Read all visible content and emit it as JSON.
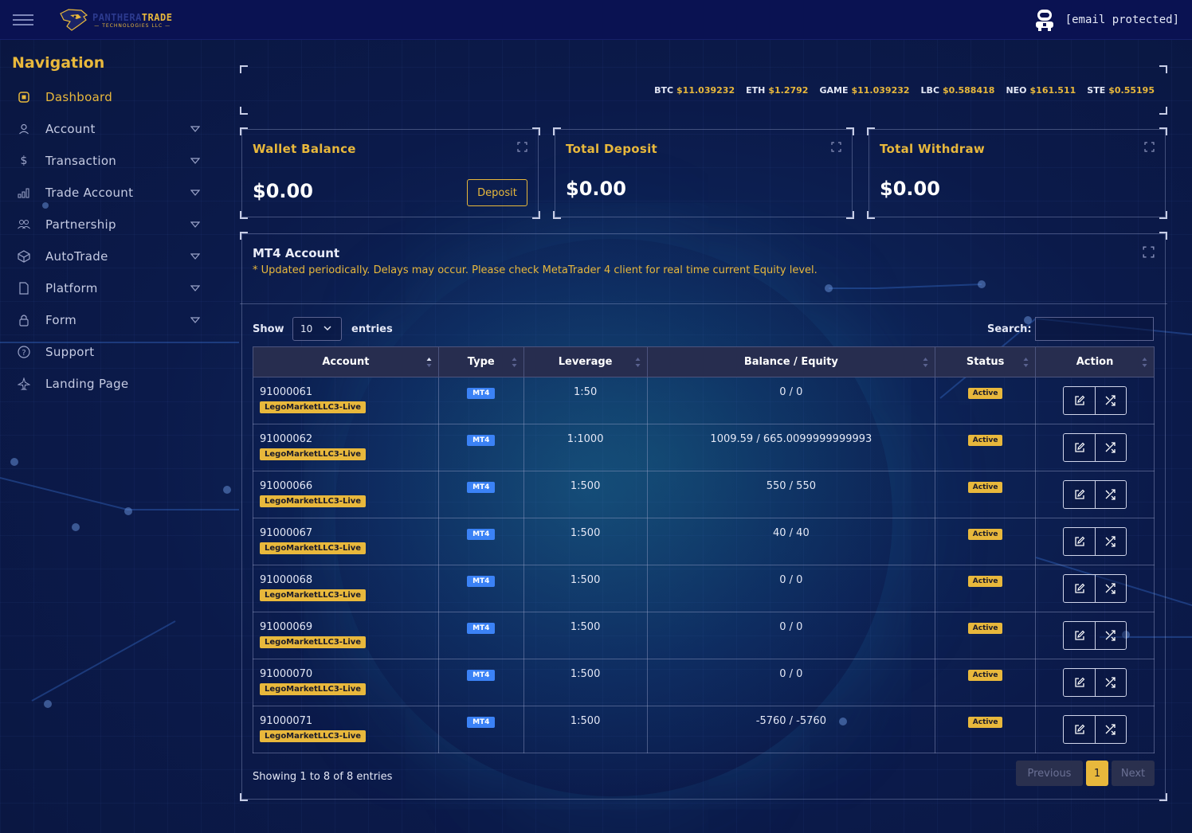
{
  "brand": {
    "name_part1": "PANTHERA",
    "name_part2": "TRADE",
    "tagline": "— TECHNOLOGIES LLC —"
  },
  "user": {
    "email": "[email protected]",
    "avatar_icon": "robot-avatar-icon"
  },
  "sidebar": {
    "title": "Navigation",
    "items": [
      {
        "label": "Dashboard",
        "icon": "chip-icon",
        "active": true,
        "has_submenu": false
      },
      {
        "label": "Account",
        "icon": "user-icon",
        "has_submenu": true
      },
      {
        "label": "Transaction",
        "icon": "dollar-icon",
        "has_submenu": true
      },
      {
        "label": "Trade Account",
        "icon": "bar-chart-icon",
        "has_submenu": true
      },
      {
        "label": "Partnership",
        "icon": "users-icon",
        "has_submenu": true
      },
      {
        "label": "AutoTrade",
        "icon": "cube-icon",
        "has_submenu": true
      },
      {
        "label": "Platform",
        "icon": "file-icon",
        "has_submenu": true
      },
      {
        "label": "Form",
        "icon": "lock-icon",
        "has_submenu": true
      },
      {
        "label": "Support",
        "icon": "help-circle-icon",
        "has_submenu": false
      },
      {
        "label": "Landing Page",
        "icon": "plane-icon",
        "has_submenu": false
      }
    ]
  },
  "ticker": [
    {
      "symbol": "BTC",
      "value": "$11.039232"
    },
    {
      "symbol": "ETH",
      "value": "$1.2792"
    },
    {
      "symbol": "GAME",
      "value": "$11.039232"
    },
    {
      "symbol": "LBC",
      "value": "$0.588418"
    },
    {
      "symbol": "NEO",
      "value": "$161.511"
    },
    {
      "symbol": "STE",
      "value": "$0.55195"
    }
  ],
  "cards": {
    "wallet": {
      "title": "Wallet Balance",
      "value": "$0.00",
      "button": "Deposit"
    },
    "deposit": {
      "title": "Total Deposit",
      "value": "$0.00"
    },
    "withdraw": {
      "title": "Total Withdraw",
      "value": "$0.00"
    }
  },
  "mt4": {
    "title": "MT4 Account",
    "note": "* Updated periodically. Delays may occur. Please check MetaTrader 4 client for real time current Equity level.",
    "show_label": "Show",
    "entries_value": "10",
    "entries_label": "entries",
    "search_label": "Search:",
    "search_value": "",
    "columns": [
      "Account",
      "Type",
      "Leverage",
      "Balance / Equity",
      "Status",
      "Action"
    ],
    "rows": [
      {
        "account": "91000061",
        "tag": "LegoMarketLLC3-Live",
        "type": "MT4",
        "leverage": "1:50",
        "balance": "0 / 0",
        "status": "Active"
      },
      {
        "account": "91000062",
        "tag": "LegoMarketLLC3-Live",
        "type": "MT4",
        "leverage": "1:1000",
        "balance": "1009.59 / 665.0099999999993",
        "status": "Active"
      },
      {
        "account": "91000066",
        "tag": "LegoMarketLLC3-Live",
        "type": "MT4",
        "leverage": "1:500",
        "balance": "550 / 550",
        "status": "Active"
      },
      {
        "account": "91000067",
        "tag": "LegoMarketLLC3-Live",
        "type": "MT4",
        "leverage": "1:500",
        "balance": "40 / 40",
        "status": "Active"
      },
      {
        "account": "91000068",
        "tag": "LegoMarketLLC3-Live",
        "type": "MT4",
        "leverage": "1:500",
        "balance": "0 / 0",
        "status": "Active"
      },
      {
        "account": "91000069",
        "tag": "LegoMarketLLC3-Live",
        "type": "MT4",
        "leverage": "1:500",
        "balance": "0 / 0",
        "status": "Active"
      },
      {
        "account": "91000070",
        "tag": "LegoMarketLLC3-Live",
        "type": "MT4",
        "leverage": "1:500",
        "balance": "0 / 0",
        "status": "Active"
      },
      {
        "account": "91000071",
        "tag": "LegoMarketLLC3-Live",
        "type": "MT4",
        "leverage": "1:500",
        "balance": "-5760 / -5760",
        "status": "Active"
      }
    ],
    "showing_text": "Showing 1 to 8 of 8 entries",
    "pager": {
      "previous": "Previous",
      "page": "1",
      "next": "Next"
    }
  },
  "colors": {
    "accent": "#e8b83c",
    "background": "#0b1a4a",
    "topbar": "#0a1252",
    "type_badge": "#3b82f6"
  }
}
